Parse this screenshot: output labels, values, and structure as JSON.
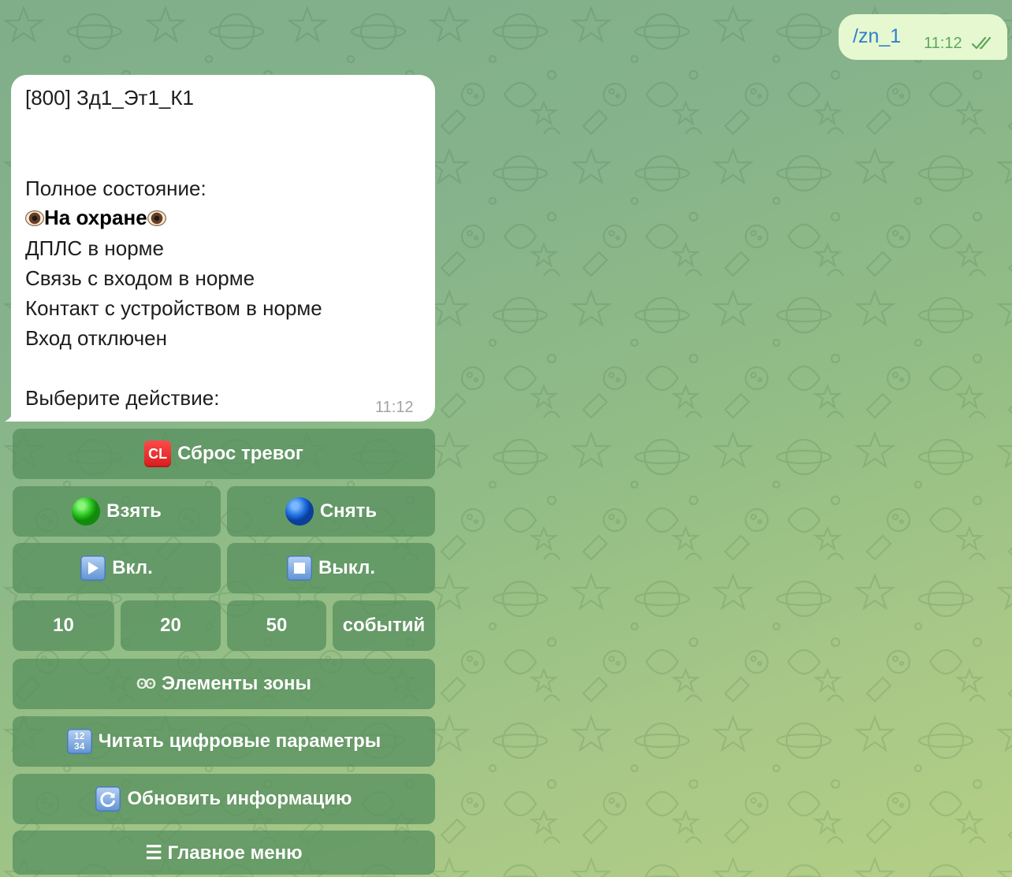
{
  "outgoing": {
    "text": "/zn_1",
    "time": "11:12"
  },
  "incoming": {
    "title": "[800] Зд1_Эт1_К1",
    "full_state_label": "Полное состояние:",
    "guard_status": "На охране",
    "line_dpls": "ДПЛС в норме",
    "line_link": "Связь с входом в норме",
    "line_contact": "Контакт с устройством в норме",
    "line_input": "Вход отключен",
    "choose_action": "Выберите действие:",
    "time": "11:12"
  },
  "keyboard": {
    "reset_alarms": "Сброс тревог",
    "reset_icon_text": "CL",
    "arm": "Взять",
    "disarm": "Снять",
    "on": "Вкл.",
    "off": "Выкл.",
    "ev10": "10",
    "ev20": "20",
    "ev50": "50",
    "events": "событий",
    "zone_elements": "Элементы зоны",
    "zone_elements_icon": "ʘʘ",
    "read_digital": "Читать цифровые параметры",
    "num_icon_top": "12",
    "num_icon_bottom": "34",
    "refresh_info": "Обновить информацию",
    "main_menu": "☰ Главное меню"
  },
  "icons": {
    "reset": "cl-icon",
    "arm": "green-circle-icon",
    "disarm": "blue-circle-icon",
    "on": "play-icon",
    "off": "stop-icon",
    "zone": "eyes-icon",
    "digital": "input-numbers-icon",
    "refresh": "refresh-icon",
    "guard": "eye-icon"
  },
  "colors": {
    "outgoing_bubble": "#e6f8cf",
    "outgoing_text": "#2e7fcf",
    "button_bg": "#58915f",
    "incoming_bubble": "#ffffff"
  }
}
